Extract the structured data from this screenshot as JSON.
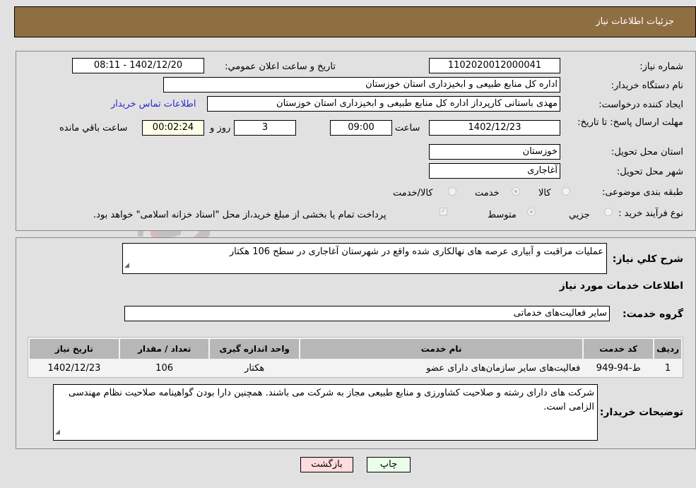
{
  "header": {
    "title": "جزئیات اطلاعات نیاز"
  },
  "form": {
    "need_number": {
      "label": "شماره نیاز:",
      "value": "1102020012000041"
    },
    "announce_datetime": {
      "label": "تاريخ و ساعت اعلان عمومي:",
      "value": "1402/12/20 - 08:11"
    },
    "buyer_org": {
      "label": "نام دستگاه خریدار:",
      "value": "اداره کل منابع طبیعی و ابخیزداری استان خوزستان"
    },
    "requester": {
      "label": "ایجاد کننده درخواست:",
      "value": "مهدی باستانی کارپرداز اداره کل منابع طبیعی و ابخیزداری استان خوزستان"
    },
    "buyer_contact_link": "اطلاعات تماس خریدار",
    "deadline": {
      "label": "مهلت ارسال پاسخ: تا تاریخ:",
      "date": "1402/12/23",
      "time_label": "ساعت",
      "time": "09:00",
      "days": "3",
      "days_label": "روز و",
      "remaining": "00:02:24",
      "remaining_label": "ساعت باقي مانده"
    },
    "province": {
      "label": "استان محل تحویل:",
      "value": "خوزستان"
    },
    "city": {
      "label": "شهر محل تحویل:",
      "value": "آغاجاری"
    },
    "category": {
      "label": "طبقه بندی موضوعی:",
      "options": [
        "کالا",
        "خدمت",
        "کالا/خدمت"
      ],
      "selected": "خدمت"
    },
    "process_type": {
      "label": "نوع فرآیند خرید :",
      "options": [
        "جزيي",
        "متوسط"
      ],
      "selected": "متوسط",
      "treasury_note": "پرداخت تمام یا بخشی از مبلغ خرید،از محل \"اسناد خزانه اسلامی\" خواهد بود.",
      "treasury_checked": true
    }
  },
  "description": {
    "label": "شرح كلي نياز:",
    "value": "عملیات مراقبت و آبیاری عرصه های نهالکاری شده واقع در شهرستان آغاجاری در سطح 106 هکتار"
  },
  "services_section": {
    "title": "اطلاعات خدمات مورد نياز",
    "group_label": "گروه خدمت:",
    "group_value": "سایر فعالیت‌های خدماتی",
    "table": {
      "headers": [
        "رديف",
        "کد خدمت",
        "نام خدمت",
        "واحد اندازه گیری",
        "تعداد / مقدار",
        "تاریخ نیاز"
      ],
      "rows": [
        [
          "1",
          "ط-94-949",
          "فعالیت‌های سایر سازمان‌های دارای عضو",
          "هکتار",
          "106",
          "1402/12/23"
        ]
      ]
    }
  },
  "buyer_notes": {
    "label": "توضیحات خریدار:",
    "value": "شرکت های دارای رشته و صلاحیت کشاورزی و منابع طبیعی مجاز به شرکت می باشند. همچنین دارا بودن گواهینامه صلاحیت نظام مهندسی الزامی است."
  },
  "buttons": {
    "print": "چاپ",
    "back": "بازگشت"
  },
  "watermark": "AriaTender.neT",
  "colors": {
    "header_bg": "#8f6e42",
    "print_bg": "#eaffea",
    "back_bg": "#ffdcdc",
    "remaining_bg": "#ffffe6",
    "link": "#2a2ad0"
  }
}
